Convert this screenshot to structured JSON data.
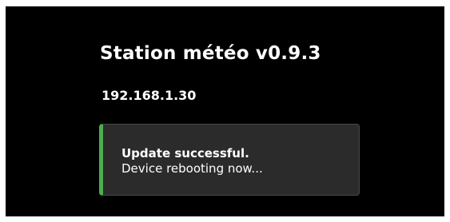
{
  "header": {
    "title": "Station météo v0.9.3",
    "ip_address": "192.168.1.30"
  },
  "status": {
    "title": "Update successful.",
    "message": "Device rebooting now...",
    "accent_color": "#4cae4c",
    "background_color": "#2b2b2b"
  }
}
